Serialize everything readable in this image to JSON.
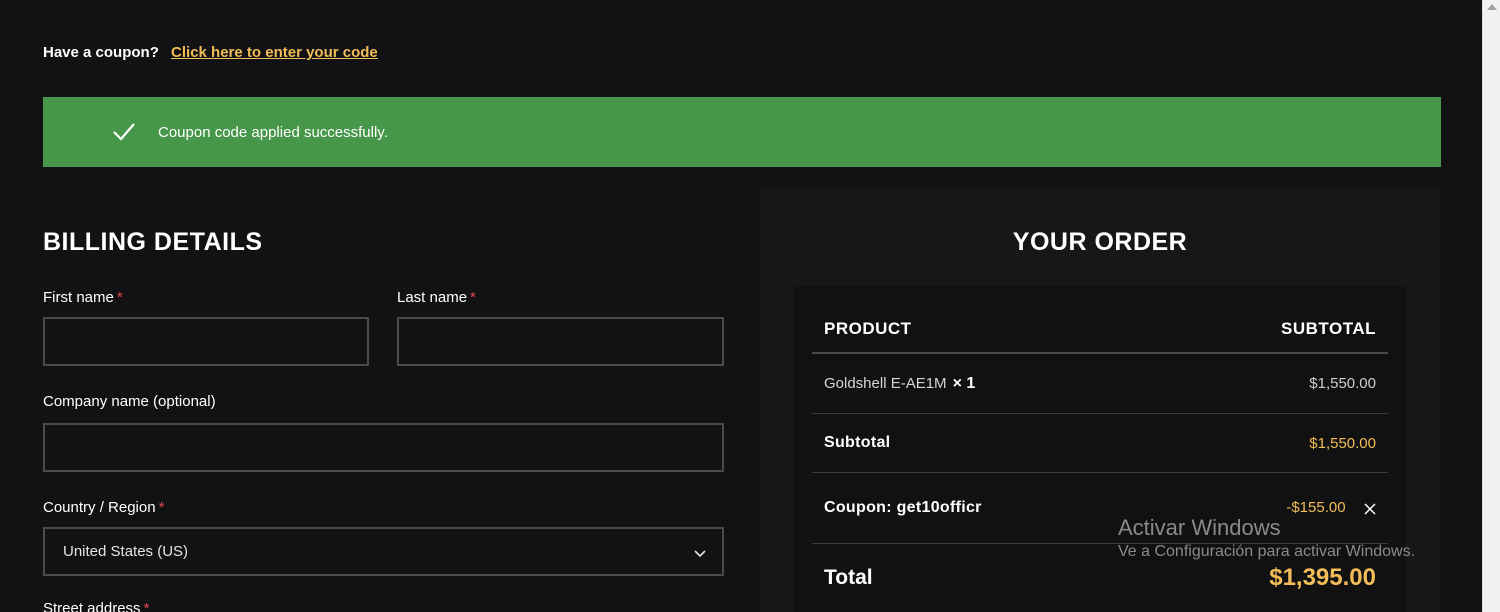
{
  "coupon_prompt": {
    "question": "Have a coupon?",
    "link": "Click here to enter your code"
  },
  "notice": {
    "message": "Coupon code applied successfully.",
    "color": "#469749",
    "icon": "checkmark-icon"
  },
  "billing": {
    "title": "BILLING DETAILS",
    "first_name_label": "First name",
    "last_name_label": "Last name",
    "company_label": "Company name (optional)",
    "country_label": "Country / Region",
    "country_value": "United States (US)",
    "street_label": "Street address",
    "required_marker": "*"
  },
  "order": {
    "title": "YOUR ORDER",
    "col_product": "PRODUCT",
    "col_subtotal": "SUBTOTAL",
    "item_name": "Goldshell E-AE1M",
    "item_qty": "× 1",
    "item_price": "$1,550.00",
    "subtotal_label": "Subtotal",
    "subtotal_value": "$1,550.00",
    "coupon_label": "Coupon: get10officr",
    "coupon_value": "-$155.00",
    "total_label": "Total",
    "total_value": "$1,395.00"
  },
  "windows_watermark": {
    "line1": "Activar Windows",
    "line2": "Ve a Configuración para activar Windows."
  },
  "accent_color": "#f2bd58",
  "required_color": "#e2474b"
}
